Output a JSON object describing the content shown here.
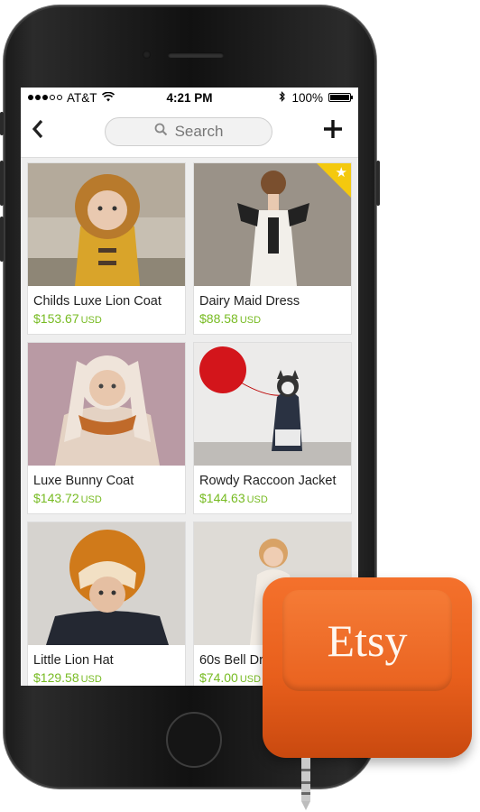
{
  "status_bar": {
    "carrier": "AT&T",
    "time": "4:21 PM",
    "battery": "100%",
    "signal_dots_filled": 3,
    "signal_dots_total": 5,
    "battery_level": 1.0
  },
  "nav": {
    "back_icon": "chevron-left-icon",
    "search_placeholder": "Search",
    "add_icon": "plus-icon"
  },
  "listings": [
    {
      "title": "Childs Luxe Lion Coat",
      "price": "$153.67",
      "currency": "USD",
      "favorited": false
    },
    {
      "title": "Dairy Maid Dress",
      "price": "$88.58",
      "currency": "USD",
      "favorited": true
    },
    {
      "title": "Luxe Bunny Coat",
      "price": "$143.72",
      "currency": "USD",
      "favorited": false
    },
    {
      "title": "Rowdy Raccoon Jacket",
      "price": "$144.63",
      "currency": "USD",
      "favorited": false
    },
    {
      "title": "Little Lion Hat",
      "price": "$129.58",
      "currency": "USD",
      "favorited": false
    },
    {
      "title": "60s Bell Dr",
      "price": "$74.00",
      "currency": "USD",
      "favorited": false
    }
  ],
  "reader": {
    "logo": "Etsy",
    "color": "#e8651f"
  },
  "colors": {
    "price": "#77bb22",
    "favorite_badge": "#f4c90e"
  }
}
